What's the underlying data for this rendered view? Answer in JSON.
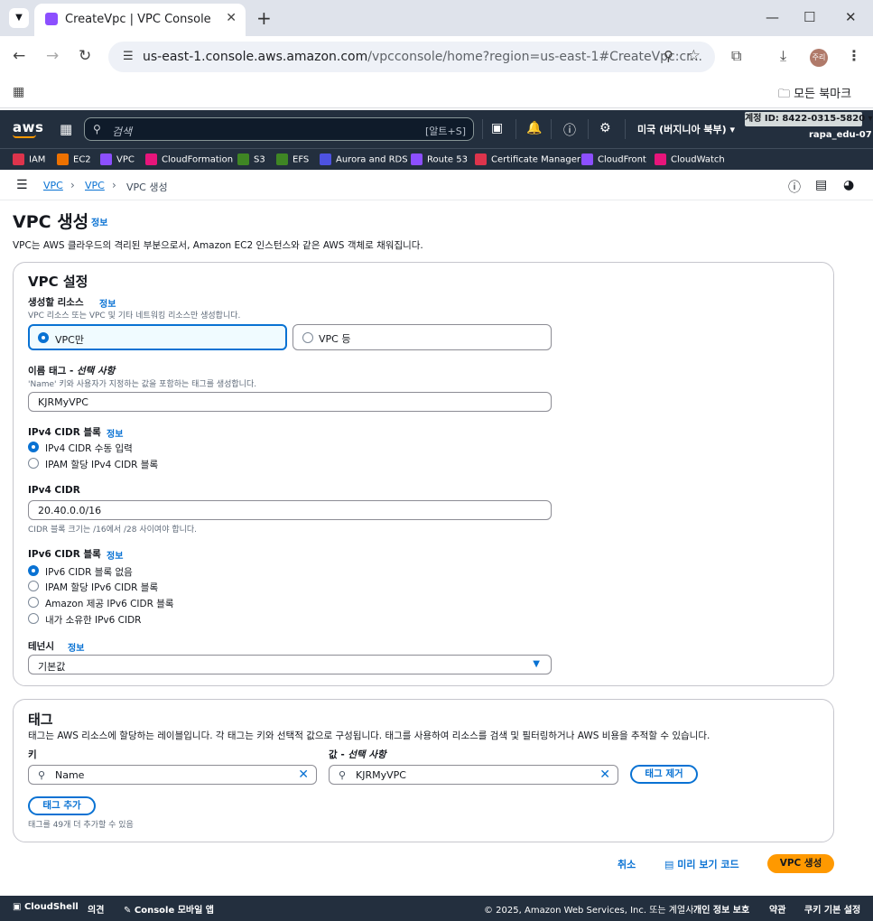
{
  "browser": {
    "tab_title": "CreateVpc | VPC Console",
    "url_host": "us-east-1.console.aws.amazon.com",
    "url_rest": "/vpcconsole/home?region=us-east-1#CreateVpc:cr...",
    "avatar_text": "주리",
    "bookmark_folder": "모든 북마크"
  },
  "aws_header": {
    "logo": "aws",
    "search_placeholder": "검색",
    "search_shortcut": "[알트+S]",
    "region": "미국 (버지니아 북부) ▾",
    "account_id": "계정 ID: 8422-0315-5820 ▾",
    "user": "rapa_edu-07"
  },
  "favorites": [
    {
      "label": "IAM",
      "color": "#dd344c"
    },
    {
      "label": "EC2",
      "color": "#ed7100"
    },
    {
      "label": "VPC",
      "color": "#8c4fff"
    },
    {
      "label": "CloudFormation",
      "color": "#e7157b"
    },
    {
      "label": "S3",
      "color": "#3f8624"
    },
    {
      "label": "EFS",
      "color": "#3f8624"
    },
    {
      "label": "Aurora and RDS",
      "color": "#4d52e1"
    },
    {
      "label": "Route 53",
      "color": "#8c4fff"
    },
    {
      "label": "Certificate Manager",
      "color": "#dd344c"
    },
    {
      "label": "CloudFront",
      "color": "#8c4fff"
    },
    {
      "label": "CloudWatch",
      "color": "#e7157b"
    }
  ],
  "breadcrumb": {
    "items": [
      "VPC",
      "VPC",
      "VPC 생성"
    ]
  },
  "page": {
    "title": "VPC 생성",
    "info": "정보",
    "description": "VPC는 AWS 클라우드의 격리된 부분으로서, Amazon EC2 인스턴스와 같은 AWS 객체로 채워집니다."
  },
  "vpc_settings": {
    "heading": "VPC 설정",
    "resources": {
      "label": "생성할 리소스",
      "info": "정보",
      "hint": "VPC 리소스 또는 VPC 및 기타 네트워킹 리소스만 생성합니다.",
      "options": [
        "VPC만",
        "VPC 등"
      ]
    },
    "name_tag": {
      "label_main": "이름 태그 - ",
      "label_italic": "선택 사항",
      "hint": "'Name' 키와 사용자가 지정하는 값을 포함하는 태그를 생성합니다.",
      "value": "KJRMyVPC"
    },
    "ipv4_block": {
      "label": "IPv4 CIDR 블록",
      "info": "정보",
      "options": [
        "IPv4 CIDR 수동 입력",
        "IPAM 할당 IPv4 CIDR 블록"
      ]
    },
    "ipv4_cidr": {
      "label": "IPv4 CIDR",
      "value": "20.40.0.0/16",
      "hint": "CIDR 블록 크기는 /16에서 /28 사이여야 합니다."
    },
    "ipv6_block": {
      "label": "IPv6 CIDR 블록",
      "info": "정보",
      "options": [
        "IPv6 CIDR 블록 없음",
        "IPAM 할당 IPv6 CIDR 블록",
        "Amazon 제공 IPv6 CIDR 블록",
        "내가 소유한 IPv6 CIDR"
      ]
    },
    "tenancy": {
      "label": "테넌시",
      "info": "정보",
      "value": "기본값"
    }
  },
  "tags": {
    "heading": "태그",
    "description": "태그는 AWS 리소스에 할당하는 레이블입니다. 각 태그는 키와 선택적 값으로 구성됩니다. 태그를 사용하여 리소스를 검색 및 필터링하거나 AWS 비용을 추적할 수 있습니다.",
    "key_label": "키",
    "value_label_main": "값 - ",
    "value_label_italic": "선택 사항",
    "key_value": "Name",
    "value_value": "KJRMyVPC",
    "remove_button": "태그 제거",
    "add_button": "태그 추가",
    "remaining": "태그를 49개 더 추가할 수 있음"
  },
  "actions": {
    "cancel": "취소",
    "preview": "미리 보기 코드",
    "create": "VPC 생성"
  },
  "footer": {
    "cloudshell": "CloudShell",
    "feedback": "의견",
    "mobile": "Console 모바일 앱",
    "copyright": "© 2025, Amazon Web Services, Inc. 또는 계열사.",
    "privacy": "개인 정보 보호",
    "terms": "약관",
    "cookies": "쿠키 기본 설정"
  }
}
